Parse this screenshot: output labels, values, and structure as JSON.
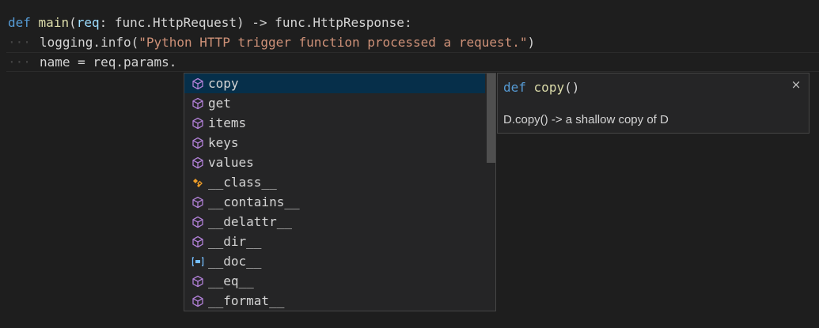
{
  "code": {
    "line1": {
      "kw_def": "def",
      "fn_name": "main",
      "open_paren": "(",
      "param": "req",
      "annotation": ": func.HttpRequest) -> func.HttpResponse:"
    },
    "line2": {
      "call": "logging.info(",
      "string": "\"Python HTTP trigger function processed a request.\"",
      "close": ")"
    },
    "line3": {
      "text": "name = req.params."
    }
  },
  "suggestions": {
    "items": [
      {
        "label": "copy",
        "icon": "method-cube-icon",
        "selected": true
      },
      {
        "label": "get",
        "icon": "method-cube-icon"
      },
      {
        "label": "items",
        "icon": "method-cube-icon"
      },
      {
        "label": "keys",
        "icon": "method-cube-icon"
      },
      {
        "label": "values",
        "icon": "method-cube-icon"
      },
      {
        "label": "__class__",
        "icon": "class-icon"
      },
      {
        "label": "__contains__",
        "icon": "method-cube-icon"
      },
      {
        "label": "__delattr__",
        "icon": "method-cube-icon"
      },
      {
        "label": "__dir__",
        "icon": "method-cube-icon"
      },
      {
        "label": "__doc__",
        "icon": "field-bracket-icon"
      },
      {
        "label": "__eq__",
        "icon": "method-cube-icon"
      },
      {
        "label": "__format__",
        "icon": "method-cube-icon"
      }
    ]
  },
  "docs": {
    "kw": "def",
    "name": "copy",
    "parens": "()",
    "description": "D.copy() -> a shallow copy of D",
    "close": "×"
  },
  "colors": {
    "method_icon": "#b180d7",
    "class_icon": "#ee9d28",
    "field_icon": "#75beff",
    "selected_bg": "#062f4a"
  }
}
